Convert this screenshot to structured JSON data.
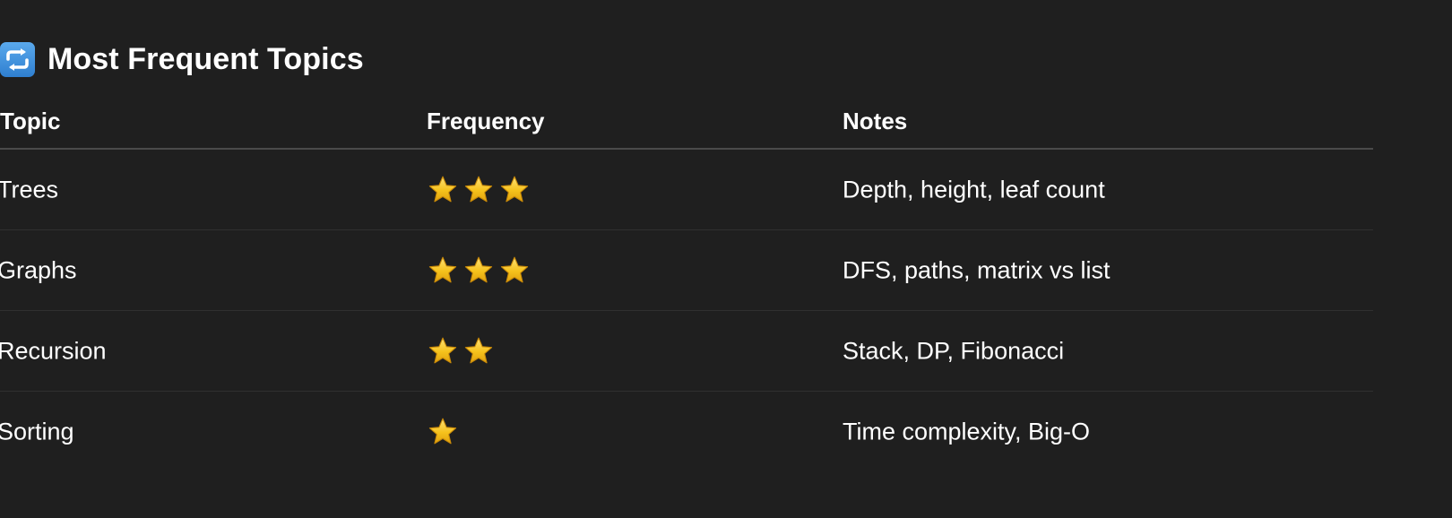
{
  "section": {
    "icon": "repeat-icon",
    "title": "Most Frequent Topics"
  },
  "table": {
    "columns": [
      "Topic",
      "Frequency",
      "Notes"
    ],
    "rows": [
      {
        "topic": "Trees",
        "frequency": 3,
        "notes": "Depth, height, leaf count"
      },
      {
        "topic": "Graphs",
        "frequency": 3,
        "notes": "DFS, paths, matrix vs list"
      },
      {
        "topic": "Recursion",
        "frequency": 2,
        "notes": "Stack, DP, Fibonacci"
      },
      {
        "topic": "Sorting",
        "frequency": 1,
        "notes": "Time complexity, Big-O"
      }
    ]
  },
  "colors": {
    "background": "#1f1f1f",
    "text": "#ffffff",
    "star": "#f6c21c",
    "icon": "#3f8ede"
  }
}
